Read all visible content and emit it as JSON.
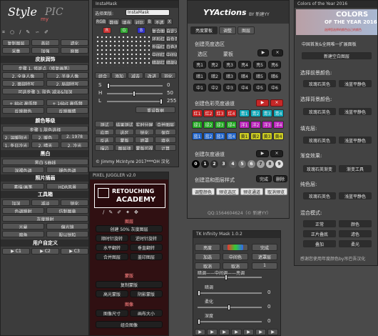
{
  "p1": {
    "logo1": "Style",
    "logo2": "my",
    "logo3": "PIC",
    "r1": [
      "复制图层",
      "盖印",
      "滤化"
    ],
    "r2": [
      "采集",
      "加强",
      "原图"
    ],
    "s_skin": "皮肤润饰",
    "skin_rows": [
      [
        "步骤 1. 修斑点（修复画笔）"
      ],
      [
        "2. 全身人像",
        "2. 半身人像"
      ],
      [
        "2. 面部特写",
        "2. 局部特写"
      ],
      [
        "可选步骤 3. 肤色 减淡&加深"
      ]
    ],
    "r_8": [
      "+ 8bit 高低频",
      "+ 16bit 高低频"
    ],
    "r_exp": [
      "反映颜色",
      "反映眼睛"
    ],
    "s_color": "颜色等级",
    "color_rows": [
      [
        "步骤 1.肤色选择"
      ],
      [
        "2. 温暖阳光",
        "2. 暖色",
        "2. 1978"
      ],
      [
        "1. 冬日冷光",
        "2. 晴天",
        "2. 冷光"
      ]
    ],
    "s_bw": "黑白",
    "bw_rows": [
      [
        "黑白 S曲线"
      ],
      [
        "深褐色调",
        "褪色色调"
      ]
    ],
    "s_fx": "照片插画",
    "fx_rows": [
      [
        "素描/画笔",
        "HDR风景"
      ]
    ],
    "s_tools": "工具箱",
    "tool_rows": [
      [
        "加深",
        "减淡",
        "锐化"
      ],
      [
        "色调映射",
        "仿制图章"
      ],
      [
        "灰度映射"
      ],
      [
        "光晕",
        "偏光镜"
      ],
      [
        "暗角",
        "股以锐粒"
      ]
    ],
    "s_user": "用户自定义",
    "user_btns": [
      "▶ C1",
      "▶ C2",
      "▶ C3"
    ]
  },
  "p2": {
    "title": "InstaMask",
    "sel_label": "选择面版:",
    "sel_val": "InstaMask",
    "ch_row": [
      "RGB",
      "数值",
      "填充",
      "对比",
      "B",
      "不透",
      "X"
    ],
    "grid_rows": [
      [
        "R",
        "G",
        "B",
        "复合图",
        "自定义"
      ],
      [
        "",
        "",
        "",
        "环形红",
        "自负青"
      ],
      [
        "",
        "",
        "",
        "外围红",
        "白色亮"
      ],
      [
        "",
        "",
        "",
        "中间红",
        "中间调"
      ],
      [
        "",
        "",
        "",
        "暗部红",
        "暗部调"
      ]
    ],
    "ops": [
      "组合",
      "添加",
      "减去",
      "改进",
      "羽化"
    ],
    "sliders": [
      {
        "lbl": "S",
        "val": "0"
      },
      {
        "lbl": "H",
        "val": "50"
      },
      {
        "lbl": "L",
        "val": "255"
      }
    ],
    "reset": "重设数据",
    "bottom_rows": [
      [
        "测试",
        "结果测试",
        "实时分屏",
        "合并图层"
      ],
      [
        "应用",
        "选区",
        "锐化",
        "保存"
      ],
      [
        "反选",
        "蒙版",
        "遮罩",
        "填充"
      ],
      [
        "描边",
        "图层项",
        "蒙版可视",
        "计算"
      ]
    ],
    "credit": "© Jimmy McIntyre 2017***OH 汉化"
  },
  "p3": {
    "title": "PIXEL JUGGLER v2.0",
    "banner1": "RETOUCHING",
    "banner2": "ACADEMY",
    "s1": "图层",
    "rows1": [
      [
        "创建 50% 灰度图层"
      ],
      [
        "顺时针旋转",
        "逆时针旋转"
      ],
      [
        "水平翻转",
        "垂直翻转"
      ],
      [
        "合并图层",
        "盖印图层"
      ]
    ],
    "s2": "蒙版",
    "rows2": [
      [
        "复制蒙版"
      ],
      [
        "高光蒙版",
        "阴影蒙版"
      ]
    ],
    "s3": "图像",
    "rows3": [
      [
        "图像尺寸",
        "画布大小"
      ],
      [
        "组合图像"
      ]
    ]
  },
  "p4": {
    "logo": "YYActions",
    "by": "BY  新建YY",
    "tabs": [
      "亮度蒙板",
      "调整",
      "图层"
    ],
    "s1": "创建亮度选区",
    "r1": [
      "选区",
      "蒙板"
    ],
    "play": "▶",
    "clear": "×",
    "light": [
      [
        "亮1",
        "亮2",
        "亮3",
        "亮4",
        "亮5",
        "亮6"
      ],
      [
        "暗1",
        "暗2",
        "暗3",
        "暗4",
        "暗5",
        "暗6"
      ],
      [
        "中1",
        "中2",
        "中3",
        "中4",
        "中5",
        "中6"
      ]
    ],
    "s2": "创建色彩亮度通道",
    "colors": [
      [
        "红1",
        "红2",
        "红3",
        "红4",
        "青1",
        "青2",
        "青3",
        "青4"
      ],
      [
        "绿1",
        "绿2",
        "绿3",
        "绿4",
        "洋1",
        "洋2",
        "洋3",
        "洋4"
      ],
      [
        "蓝1",
        "蓝2",
        "蓝3",
        "蓝4",
        "黄1",
        "黄2",
        "黄3",
        "黄4"
      ]
    ],
    "s3": "创建灰度通道",
    "gray": [
      "0",
      "1",
      "2",
      "3",
      "4",
      "5",
      "6",
      "7",
      "8",
      "9"
    ],
    "s4": "创建混和图层样式",
    "bottom": [
      "调整颜色",
      "预览选区",
      "预览通道",
      "取消预览"
    ],
    "r4": [
      "完成",
      "删除"
    ],
    "qq": "QQ:1564604624（© 新建YY）"
  },
  "p5": {
    "title": "Colors of the Year 2016",
    "b1": "COLORS",
    "b2": "OF THE YEAR 2016",
    "b3": "选择您选择的颜色自己的颜色",
    "sub": "中国首发&全网唯一扩展面板",
    "new_layer": "新建空白图层",
    "g": [
      {
        "label": "选择前景颜色:",
        "btns": [
          "玫瑰石英色",
          "浅蓝平静色"
        ]
      },
      {
        "label": "选择背景颜色:",
        "btns": [
          "玫瑰石英色",
          "浅蓝平静色"
        ]
      },
      {
        "label": "填充层:",
        "btns": [
          "玫瑰石英色",
          "浅蓝平静色"
        ]
      },
      {
        "label": "渐变效果:",
        "btns": [
          "玫瑰石英渐变",
          "渐变工具"
        ]
      },
      {
        "label": "纯色层:",
        "btns": [
          "玫瑰石英色",
          "浅蓝平静色"
        ]
      }
    ],
    "blend": "混合模式:",
    "blend_rows": [
      [
        "正常",
        "颜色"
      ],
      [
        "正片叠底",
        "滤色"
      ],
      [
        "叠加",
        "柔光"
      ]
    ],
    "thanks": "感谢您使用年度颜色by吊巴吾汉化"
  },
  "p6": {
    "title": "TK Infinity Mask 1.0.2",
    "r1": [
      "亮度",
      "饱和度",
      "完成"
    ],
    "r2": [
      "加选",
      "中间色",
      "遮罩层"
    ],
    "r3": [
      "取消",
      "取消",
      "1"
    ],
    "top_lbl": "暗调——中间调——亮调",
    "sliders": [
      {
        "lbl": "暗调",
        "val": "0"
      },
      {
        "lbl": "柔化",
        "val": "0"
      },
      {
        "lbl": "深度",
        "val": "0"
      }
    ],
    "bottom": [
      "▶",
      "▶",
      "▶",
      "▶",
      "▶",
      "▶",
      "▶"
    ]
  }
}
